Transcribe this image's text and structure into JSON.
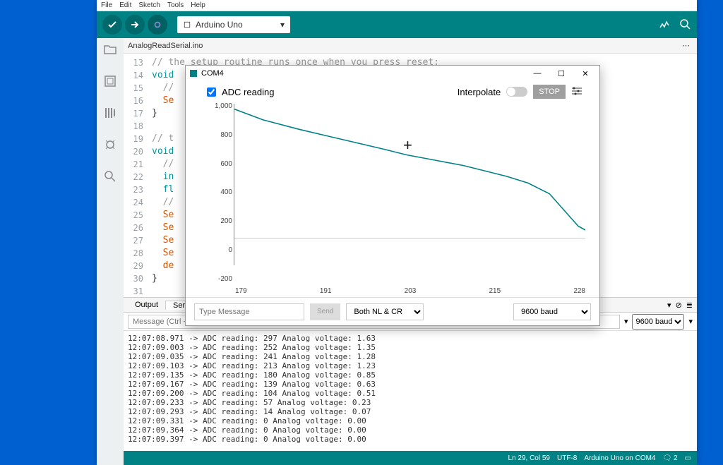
{
  "menus": [
    "File",
    "Edit",
    "Sketch",
    "Tools",
    "Help"
  ],
  "toolbar": {
    "board_label": "Arduino Uno"
  },
  "tab": {
    "filename": "AnalogReadSerial.ino"
  },
  "editor_lines": [
    {
      "n": 13,
      "text": "// the setup routine runs once when you press reset:",
      "cls": "cmt"
    },
    {
      "n": 14,
      "text": "void",
      "cls": "kw"
    },
    {
      "n": 15,
      "text": "  //",
      "cls": "cmt"
    },
    {
      "n": 16,
      "text": "  Se",
      "cls": "fn"
    },
    {
      "n": 17,
      "text": "}",
      "cls": ""
    },
    {
      "n": 18,
      "text": "",
      "cls": ""
    },
    {
      "n": 19,
      "text": "// t",
      "cls": "cmt"
    },
    {
      "n": 20,
      "text": "void",
      "cls": "kw"
    },
    {
      "n": 21,
      "text": "  //",
      "cls": "cmt"
    },
    {
      "n": 22,
      "text": "  in",
      "cls": "kw"
    },
    {
      "n": 23,
      "text": "  fl",
      "cls": "kw"
    },
    {
      "n": 24,
      "text": "  //",
      "cls": "cmt"
    },
    {
      "n": 25,
      "text": "  Se",
      "cls": "fn"
    },
    {
      "n": 26,
      "text": "  Se",
      "cls": "fn"
    },
    {
      "n": 27,
      "text": "  Se",
      "cls": "fn"
    },
    {
      "n": 28,
      "text": "  Se",
      "cls": "fn"
    },
    {
      "n": 29,
      "text": "  de",
      "cls": "fn"
    },
    {
      "n": 30,
      "text": "}",
      "cls": ""
    },
    {
      "n": 31,
      "text": "",
      "cls": ""
    }
  ],
  "output_tabs": [
    "Output",
    "Serial Mo"
  ],
  "serial_bar": {
    "placeholder": "Message (Ctrl + E",
    "baud": "9600 baud"
  },
  "serial_lines": [
    "12:07:08.971 -> ADC reading: 297 Analog voltage: 1.63",
    "12:07:09.003 -> ADC reading: 252 Analog voltage: 1.35",
    "12:07:09.035 -> ADC reading: 241 Analog voltage: 1.28",
    "12:07:09.103 -> ADC reading: 213 Analog voltage: 1.23",
    "12:07:09.135 -> ADC reading: 180 Analog voltage: 0.85",
    "12:07:09.167 -> ADC reading: 139 Analog voltage: 0.63",
    "12:07:09.200 -> ADC reading: 104 Analog voltage: 0.51",
    "12:07:09.233 -> ADC reading: 57 Analog voltage: 0.23",
    "12:07:09.293 -> ADC reading: 14 Analog voltage: 0.07",
    "12:07:09.331 -> ADC reading: 0 Analog voltage: 0.00",
    "12:07:09.364 -> ADC reading: 0 Analog voltage: 0.00",
    "12:07:09.397 -> ADC reading: 0 Analog voltage: 0.00"
  ],
  "status": {
    "pos": "Ln 29, Col 59",
    "enc": "UTF-8",
    "port": "Arduino Uno on COM4",
    "errs": "2"
  },
  "plotter": {
    "title": "COM4",
    "series_label": "ADC reading",
    "interpolate_label": "Interpolate",
    "stop_label": "STOP",
    "msg_placeholder": "Type Message",
    "send_label": "Send",
    "line_ending": "Both NL & CR",
    "baud": "9600 baud",
    "y_ticks": [
      "1,000",
      "800",
      "600",
      "400",
      "200",
      "0",
      "-200"
    ],
    "x_ticks": [
      "179",
      "191",
      "203",
      "215",
      "228"
    ]
  },
  "chart_data": {
    "type": "line",
    "title": "ADC reading",
    "xlabel": "",
    "ylabel": "",
    "xlim": [
      179,
      228
    ],
    "ylim": [
      -200,
      1000
    ],
    "series": [
      {
        "name": "ADC reading",
        "x": [
          179,
          183,
          188,
          192,
          196,
          200,
          203,
          207,
          211,
          214,
          217,
          220,
          223,
          225,
          227,
          228
        ],
        "values": [
          960,
          880,
          810,
          760,
          710,
          660,
          620,
          580,
          540,
          500,
          460,
          410,
          330,
          210,
          90,
          60
        ]
      }
    ]
  }
}
